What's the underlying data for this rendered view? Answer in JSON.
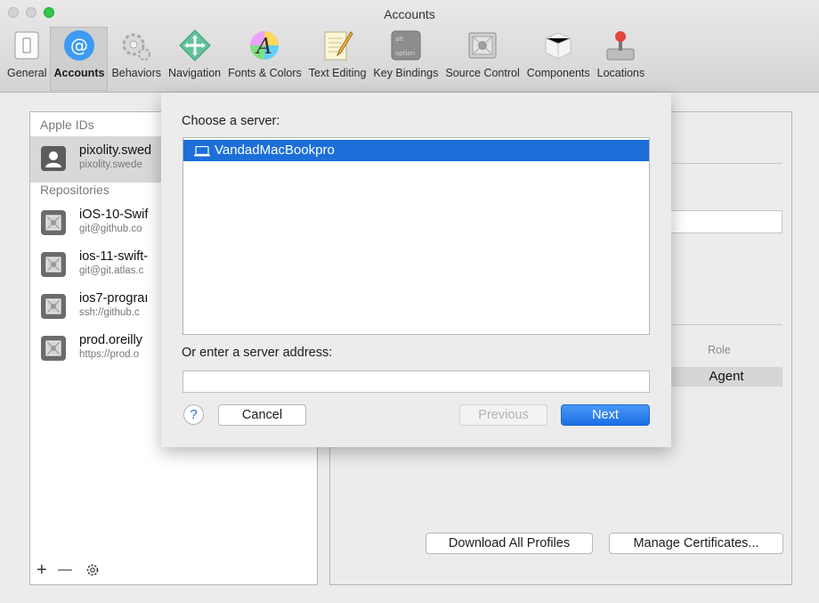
{
  "window": {
    "title": "Accounts"
  },
  "toolbar": {
    "tabs": [
      {
        "label": "General",
        "icon": "general-switch-icon"
      },
      {
        "label": "Accounts",
        "icon": "at-sign-icon",
        "selected": true
      },
      {
        "label": "Behaviors",
        "icon": "gears-icon"
      },
      {
        "label": "Navigation",
        "icon": "navigation-arrows-icon"
      },
      {
        "label": "Fonts & Colors",
        "icon": "font-palette-icon"
      },
      {
        "label": "Text Editing",
        "icon": "pencil-paper-icon"
      },
      {
        "label": "Key Bindings",
        "icon": "keyboard-key-icon"
      },
      {
        "label": "Source Control",
        "icon": "vault-icon"
      },
      {
        "label": "Components",
        "icon": "components-box-icon"
      },
      {
        "label": "Locations",
        "icon": "joystick-icon"
      }
    ],
    "key_bindings_icon_text": {
      "top": "alt",
      "bottom": "option"
    }
  },
  "sidebar": {
    "apple_ids_header": "Apple IDs",
    "apple_ids": [
      {
        "name": "pixolity.swed",
        "sub": "pixolity.swede"
      }
    ],
    "repositories_header": "Repositories",
    "repositories": [
      {
        "name": "iOS-10-Swif",
        "sub": "git@github.co"
      },
      {
        "name": "ios-11-swift-",
        "sub": "git@git.atlas.c"
      },
      {
        "name": "ios7-prograı",
        "sub": "ssh://github.c"
      },
      {
        "name": "prod.oreilly",
        "sub": "https://prod.o"
      }
    ],
    "bottom": {
      "add": "+",
      "remove": "—"
    }
  },
  "detail": {
    "role_header": "Role",
    "role_value": "Agent",
    "download_button": "Download All Profiles",
    "manage_button": "Manage Certificates..."
  },
  "sheet": {
    "choose_label": "Choose a server:",
    "servers": [
      {
        "name": "VandadMacBookpro",
        "selected": true
      }
    ],
    "address_label": "Or enter a server address:",
    "address_value": "",
    "help": "?",
    "cancel": "Cancel",
    "previous": "Previous",
    "next": "Next"
  },
  "colors": {
    "accent": "#1c6fd9",
    "selection": "#d8d8d8"
  }
}
